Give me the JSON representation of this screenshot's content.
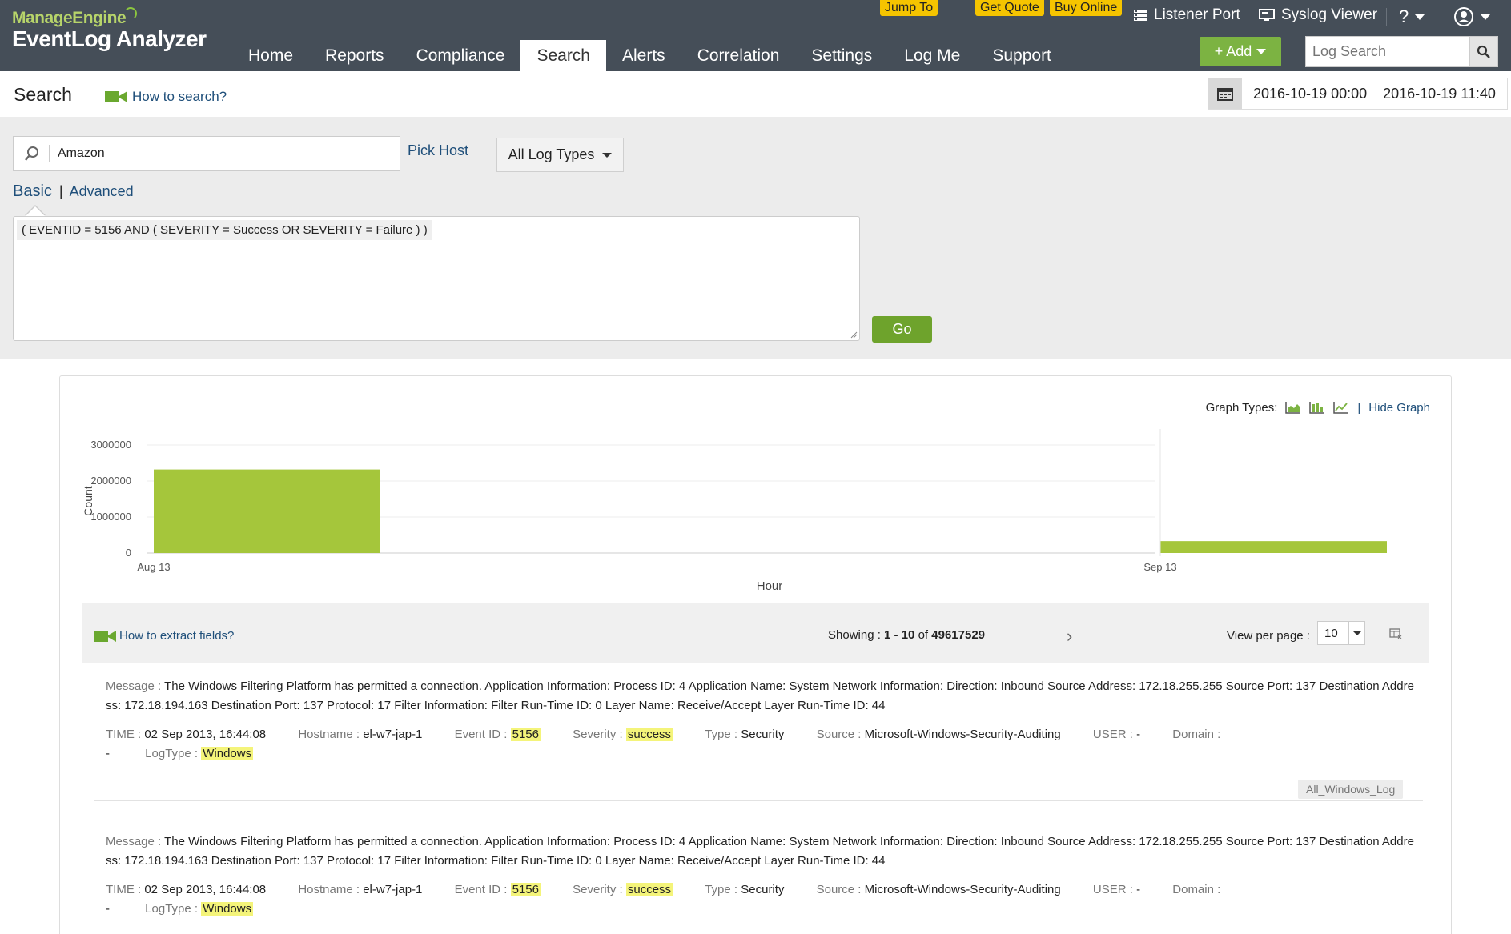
{
  "app": {
    "brand_top": "ManageEngine",
    "product": "EventLog Analyzer"
  },
  "nav": {
    "items": [
      {
        "label": "Home"
      },
      {
        "label": "Reports"
      },
      {
        "label": "Compliance"
      },
      {
        "label": "Search",
        "active": true
      },
      {
        "label": "Alerts"
      },
      {
        "label": "Correlation"
      },
      {
        "label": "Settings"
      },
      {
        "label": "Log Me"
      },
      {
        "label": "Support"
      }
    ]
  },
  "promos": {
    "jump_to": "Jump To",
    "get_quote": "Get Quote",
    "buy_online": "Buy Online"
  },
  "top_links": {
    "listener_port": "Listener Port",
    "syslog_viewer": "Syslog Viewer",
    "help": "?"
  },
  "toolbar": {
    "add_label": "+ Add",
    "log_search_placeholder": "Log Search"
  },
  "subheader": {
    "title": "Search",
    "how_to_search": "How to search?",
    "date_from": "2016-10-19 00:00",
    "date_to": "2016-10-19 11:40"
  },
  "search": {
    "host_value": "Amazon",
    "pick_host": "Pick Host",
    "log_types": "All Log Types",
    "mode_basic": "Basic",
    "mode_sep": "|",
    "mode_advanced": "Advanced",
    "query": "( EVENTID = 5156 AND ( SEVERITY = Success OR SEVERITY = Failure ) )",
    "go_label": "Go"
  },
  "graph": {
    "types_label": "Graph Types:",
    "hide_label": "Hide Graph",
    "accent": "#a5c63b"
  },
  "chart_data": {
    "type": "bar",
    "xlabel": "Hour",
    "ylabel": "Count",
    "ylim": [
      0,
      3000000
    ],
    "yticks": [
      0,
      1000000,
      2000000,
      3000000
    ],
    "ytick_labels": [
      "0",
      "1000000",
      "2000000",
      "3000000"
    ],
    "x_tick_labels": [
      "Aug 13",
      "Sep 13"
    ],
    "categories": [
      "Aug 13",
      "Sep 13"
    ],
    "values": [
      2320000,
      330000
    ],
    "grid": true
  },
  "results": {
    "how_to_extract": "How to extract fields?",
    "showing_label": "Showing :",
    "range": "1 - 10",
    "of_label": "of",
    "total": "49617529",
    "view_per_page_label": "View per page :",
    "per_page": "10",
    "entries": [
      {
        "message_label": "Message :",
        "message": "The Windows Filtering Platform has permitted a connection. Application Information: Process ID: 4 Application Name: System Network Information: Direction: Inbound Source Address: 172.18.255.255 Source Port: 137 Destination Address: 172.18.194.163 Destination Port: 137 Protocol: 17 Filter Information: Filter Run-Time ID: 0 Layer Name: Receive/Accept Layer Run-Time ID: 44",
        "time_label": "TIME :",
        "time": "02 Sep 2013, 16:44:08",
        "hostname_label": "Hostname :",
        "hostname": "el-w7-jap-1",
        "event_id_label": "Event ID :",
        "event_id": "5156",
        "severity_label": "Severity :",
        "severity": "success",
        "type_label": "Type :",
        "type": "Security",
        "source_label": "Source :",
        "source": "Microsoft-Windows-Security-Auditing",
        "user_label": "USER :",
        "user": "-",
        "domain_label": "Domain :",
        "domain": "-",
        "logtype_label": "LogType :",
        "logtype": "Windows",
        "tag": "All_Windows_Log"
      },
      {
        "message_label": "Message :",
        "message": "The Windows Filtering Platform has permitted a connection. Application Information: Process ID: 4 Application Name: System Network Information: Direction: Inbound Source Address: 172.18.255.255 Source Port: 137 Destination Address: 172.18.194.163 Destination Port: 137 Protocol: 17 Filter Information: Filter Run-Time ID: 0 Layer Name: Receive/Accept Layer Run-Time ID: 44",
        "time_label": "TIME :",
        "time": "02 Sep 2013, 16:44:08",
        "hostname_label": "Hostname :",
        "hostname": "el-w7-jap-1",
        "event_id_label": "Event ID :",
        "event_id": "5156",
        "severity_label": "Severity :",
        "severity": "success",
        "type_label": "Type :",
        "type": "Security",
        "source_label": "Source :",
        "source": "Microsoft-Windows-Security-Auditing",
        "user_label": "USER :",
        "user": "-",
        "domain_label": "Domain :",
        "domain": "-",
        "logtype_label": "LogType :",
        "logtype": "Windows"
      }
    ]
  }
}
